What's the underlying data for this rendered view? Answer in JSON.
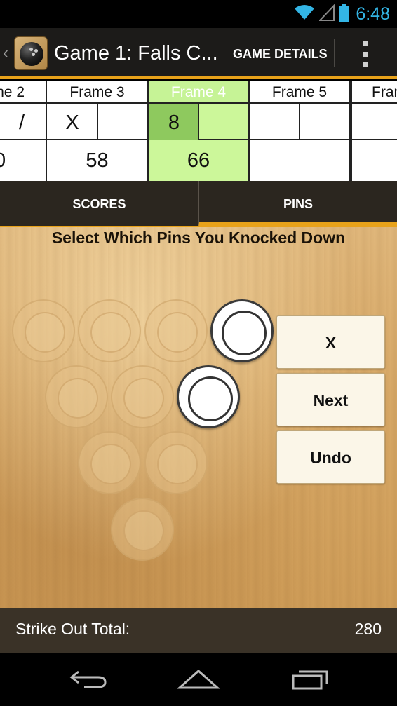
{
  "status_bar": {
    "time": "6:48",
    "icons": [
      "wifi-icon",
      "signal-icon",
      "battery-icon"
    ],
    "accent_color": "#33b5e5"
  },
  "action_bar": {
    "title": "Game 1: Falls C...",
    "details_button": "GAME DETAILS",
    "icons": [
      "up-caret-icon",
      "bowling-ball-app-icon",
      "overflow-menu-icon"
    ],
    "accent_color": "#e8a21a"
  },
  "frames": [
    {
      "header": "me 2",
      "ball1": "",
      "ball2": "/",
      "total": "0"
    },
    {
      "header": "Frame 3",
      "ball1": "X",
      "ball2": "",
      "total": "58"
    },
    {
      "header": "Frame 4",
      "ball1": "8",
      "ball2": "",
      "total": "66",
      "active": true
    },
    {
      "header": "Frame 5",
      "ball1": "",
      "ball2": "",
      "total": ""
    },
    {
      "header": "Fran",
      "ball1": "",
      "ball2": "",
      "total": ""
    }
  ],
  "tabs": {
    "scores": "SCORES",
    "pins": "PINS",
    "selected": "PINS"
  },
  "pins_panel": {
    "instruction": "Select Which Pins You Knocked Down",
    "pins_standing": [
      4,
      8
    ],
    "pins_down": [
      1,
      2,
      3,
      5,
      6,
      7,
      9,
      10
    ],
    "buttons": {
      "strike": "X",
      "next": "Next",
      "undo": "Undo"
    }
  },
  "footer": {
    "label": "Strike Out Total:",
    "value": "280"
  },
  "nav_bar": {
    "icons": [
      "back-icon",
      "home-icon",
      "recent-apps-icon"
    ]
  }
}
